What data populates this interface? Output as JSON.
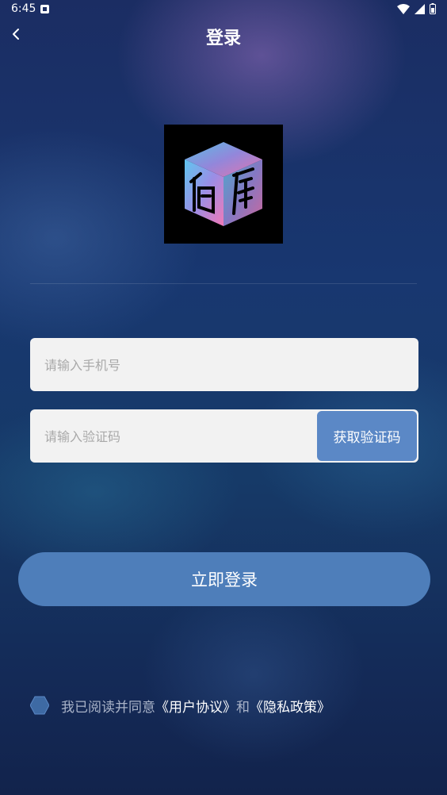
{
  "status_bar": {
    "time": "6:45"
  },
  "nav": {
    "title": "登录"
  },
  "form": {
    "phone_placeholder": "请输入手机号",
    "code_placeholder": "请输入验证码",
    "get_code_label": "获取验证码"
  },
  "login_button_label": "立即登录",
  "agreement": {
    "prefix": "我已阅读并同意",
    "user_agreement": "《用户协议》",
    "conjunction": "和",
    "privacy_policy": "《隐私政策》"
  },
  "colors": {
    "accent": "#4e7eba",
    "get_code_button": "#5b88c6",
    "field_background": "#f2f2f2"
  }
}
